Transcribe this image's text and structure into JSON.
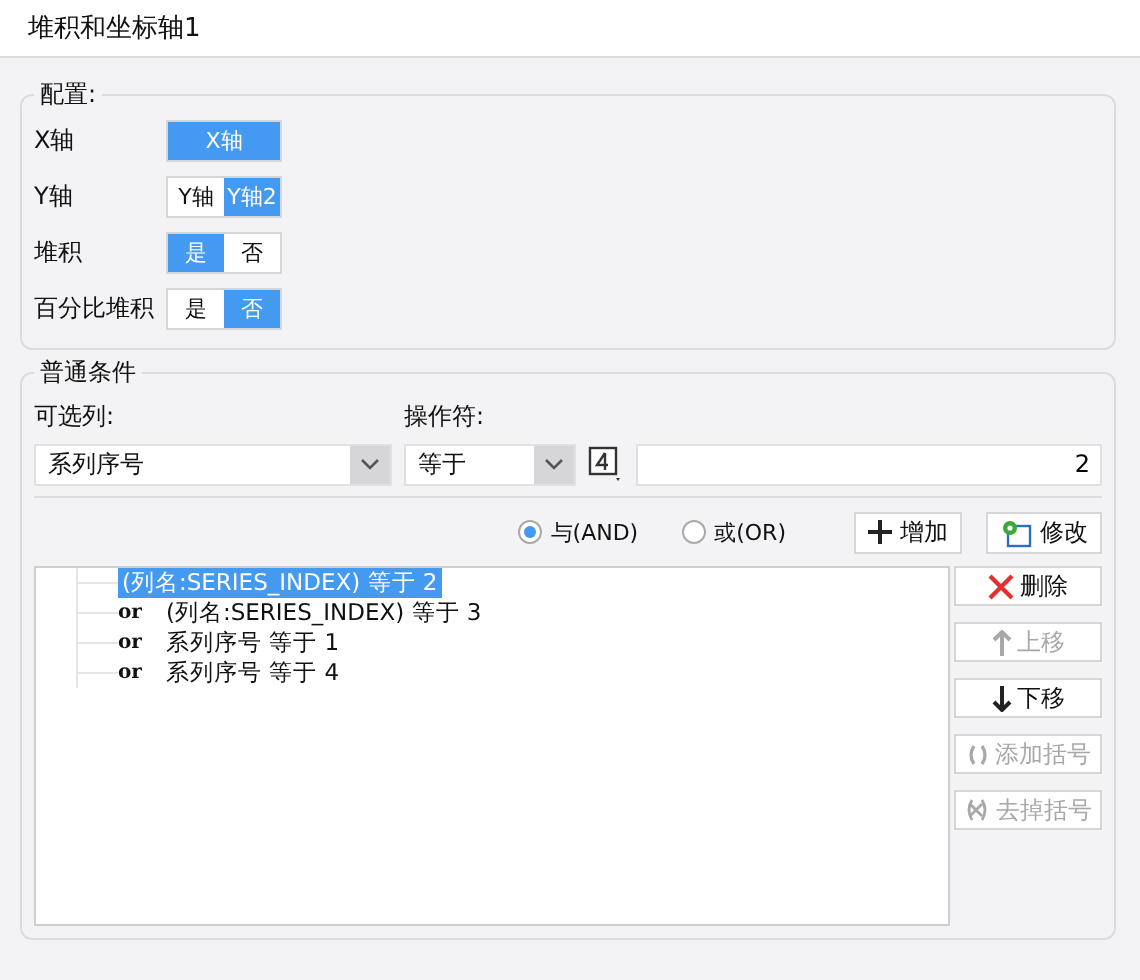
{
  "window": {
    "title": "堆积和坐标轴1"
  },
  "config": {
    "title": "配置:",
    "rows": [
      {
        "label": "X轴",
        "options": [
          {
            "label": "X轴",
            "selected": true
          }
        ]
      },
      {
        "label": "Y轴",
        "options": [
          {
            "label": "Y轴",
            "selected": false
          },
          {
            "label": "Y轴2",
            "selected": true
          }
        ]
      },
      {
        "label": "堆积",
        "options": [
          {
            "label": "是",
            "selected": true
          },
          {
            "label": "否",
            "selected": false
          }
        ]
      },
      {
        "label": "百分比堆积",
        "options": [
          {
            "label": "是",
            "selected": false
          },
          {
            "label": "否",
            "selected": true
          }
        ]
      }
    ]
  },
  "conditions": {
    "title": "普通条件",
    "column_label": "可选列:",
    "column_value": "系列序号",
    "operator_label": "操作符:",
    "operator_value": "等于",
    "value": "2",
    "logic": [
      {
        "label": "与(AND)",
        "selected": true
      },
      {
        "label": "或(OR)",
        "selected": false
      }
    ],
    "actions": [
      {
        "kind": "add",
        "label": "增加"
      },
      {
        "kind": "edit",
        "label": "修改"
      }
    ],
    "items": [
      {
        "text": "(列名:SERIES_INDEX) 等于 2",
        "selected": true
      },
      {
        "connector": "or",
        "text": "(列名:SERIES_INDEX) 等于 3",
        "selected": false
      },
      {
        "connector": "or",
        "text": "系列序号 等于 1",
        "selected": false
      },
      {
        "connector": "or",
        "text": "系列序号 等于 4",
        "selected": false
      }
    ],
    "side_buttons": [
      {
        "kind": "delete",
        "label": "删除",
        "disabled": false
      },
      {
        "kind": "up",
        "label": "上移",
        "disabled": true
      },
      {
        "kind": "down",
        "label": "下移",
        "disabled": false
      },
      {
        "kind": "add_bracket",
        "label": "添加括号",
        "disabled": true
      },
      {
        "kind": "remove_bracket",
        "label": "去掉括号",
        "disabled": true
      }
    ]
  }
}
